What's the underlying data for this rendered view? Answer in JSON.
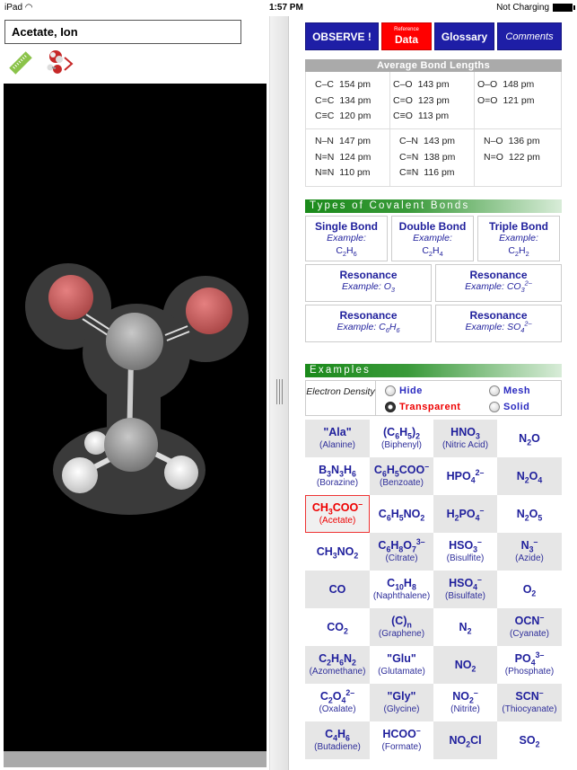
{
  "status_bar": {
    "device": "iPad",
    "time": "1:57 PM",
    "battery_text": "Not Charging"
  },
  "left": {
    "title_value": "Acetate, Ion",
    "icons": [
      "ruler-icon",
      "molecule-toggle-icon"
    ]
  },
  "nav": {
    "observe": "OBSERVE !",
    "reference_small": "Reference",
    "reference_big": "Data",
    "glossary": "Glossary",
    "comments": "Comments"
  },
  "bond_lengths": {
    "title": "Average Bond Lengths",
    "cells": [
      [
        [
          "C–C",
          "154 pm"
        ],
        [
          "C=C",
          "134 pm"
        ],
        [
          "C≡C",
          "120 pm"
        ]
      ],
      [
        [
          "C–O",
          "143 pm"
        ],
        [
          "C=O",
          "123 pm"
        ],
        [
          "C≡O",
          "113 pm"
        ]
      ],
      [
        [
          "O–O",
          "148 pm"
        ],
        [
          "O=O",
          "121 pm"
        ]
      ],
      [
        [
          "N–N",
          "147 pm"
        ],
        [
          "N=N",
          "124 pm"
        ],
        [
          "N≡N",
          "110 pm"
        ]
      ],
      [
        [
          "C–N",
          "143 pm"
        ],
        [
          "C=N",
          "138 pm"
        ],
        [
          "C≡N",
          "116 pm"
        ]
      ],
      [
        [
          "N–O",
          "136 pm"
        ],
        [
          "N=O",
          "122 pm"
        ]
      ]
    ]
  },
  "bond_types": {
    "title": "Types of Covalent Bonds",
    "example_label": "Example:",
    "row1": [
      {
        "title": "Single Bond",
        "formula_html": "C<sub>2</sub>H<sub>6</sub>"
      },
      {
        "title": "Double Bond",
        "formula_html": "C<sub>2</sub>H<sub>4</sub>"
      },
      {
        "title": "Triple Bond",
        "formula_html": "C<sub>2</sub>H<sub>2</sub>"
      }
    ],
    "row2": [
      {
        "title": "Resonance",
        "formula_html": "O<sub>3</sub>"
      },
      {
        "title": "Resonance",
        "formula_html": "CO<sub>3</sub><sup>2–</sup>"
      }
    ],
    "row3": [
      {
        "title": "Resonance",
        "formula_html": "C<sub>6</sub>H<sub>6</sub>"
      },
      {
        "title": "Resonance",
        "formula_html": "SO<sub>4</sub><sup>2–</sup>"
      }
    ]
  },
  "examples": {
    "title": "Examples",
    "electron_density_label": "Electron Density",
    "options": [
      {
        "label": "Hide",
        "selected": false
      },
      {
        "label": "Mesh",
        "selected": false
      },
      {
        "label": "Transparent",
        "selected": true
      },
      {
        "label": "Solid",
        "selected": false
      }
    ],
    "grid": [
      {
        "f": "\"Ala\"",
        "n": "(Alanine)",
        "g": true
      },
      {
        "f": "(C<sub>6</sub>H<sub>5</sub>)<sub>2</sub>",
        "n": "(Biphenyl)",
        "g": false
      },
      {
        "f": "HNO<sub>3</sub>",
        "n": "(Nitric Acid)",
        "g": true
      },
      {
        "f": "N<sub>2</sub>O",
        "n": "",
        "g": false
      },
      {
        "f": "B<sub>3</sub>N<sub>3</sub>H<sub>6</sub>",
        "n": "(Borazine)",
        "g": false
      },
      {
        "f": "C<sub>6</sub>H<sub>5</sub>COO<sup>–</sup>",
        "n": "(Benzoate)",
        "g": true
      },
      {
        "f": "HPO<sub>4</sub><sup>2–</sup>",
        "n": "",
        "g": false
      },
      {
        "f": "N<sub>2</sub>O<sub>4</sub>",
        "n": "",
        "g": true
      },
      {
        "f": "CH<sub>3</sub>COO<sup>–</sup>",
        "n": "(Acetate)",
        "g": true,
        "selected": true
      },
      {
        "f": "C<sub>6</sub>H<sub>5</sub>NO<sub>2</sub>",
        "n": "",
        "g": false
      },
      {
        "f": "H<sub>2</sub>PO<sub>4</sub><sup>–</sup>",
        "n": "",
        "g": true
      },
      {
        "f": "N<sub>2</sub>O<sub>5</sub>",
        "n": "",
        "g": false
      },
      {
        "f": "CH<sub>3</sub>NO<sub>2</sub>",
        "n": "",
        "g": false
      },
      {
        "f": "C<sub>6</sub>H<sub>8</sub>O<sub>7</sub><sup>3–</sup>",
        "n": "(Citrate)",
        "g": true
      },
      {
        "f": "HSO<sub>3</sub><sup>–</sup>",
        "n": "(Bisulfite)",
        "g": false
      },
      {
        "f": "N<sub>3</sub><sup>–</sup>",
        "n": "(Azide)",
        "g": true
      },
      {
        "f": "CO",
        "n": "",
        "g": true
      },
      {
        "f": "C<sub>10</sub>H<sub>8</sub>",
        "n": "(Naphthalene)",
        "g": false
      },
      {
        "f": "HSO<sub>4</sub><sup>–</sup>",
        "n": "(Bisulfate)",
        "g": true
      },
      {
        "f": "O<sub>2</sub>",
        "n": "",
        "g": false
      },
      {
        "f": "CO<sub>2</sub>",
        "n": "",
        "g": false
      },
      {
        "f": "(C)<sub>n</sub>",
        "n": "(Graphene)",
        "g": true
      },
      {
        "f": "N<sub>2</sub>",
        "n": "",
        "g": false
      },
      {
        "f": "OCN<sup>–</sup>",
        "n": "(Cyanate)",
        "g": true
      },
      {
        "f": "C<sub>2</sub>H<sub>6</sub>N<sub>2</sub>",
        "n": "(Azomethane)",
        "g": true
      },
      {
        "f": "\"Glu\"",
        "n": "(Glutamate)",
        "g": false
      },
      {
        "f": "NO<sub>2</sub>",
        "n": "",
        "g": true
      },
      {
        "f": "PO<sub>4</sub><sup>3–</sup>",
        "n": "(Phosphate)",
        "g": false
      },
      {
        "f": "C<sub>2</sub>O<sub>4</sub><sup>2–</sup>",
        "n": "(Oxalate)",
        "g": false
      },
      {
        "f": "\"Gly\"",
        "n": "(Glycine)",
        "g": true
      },
      {
        "f": "NO<sub>2</sub><sup>–</sup>",
        "n": "(Nitrite)",
        "g": false
      },
      {
        "f": "SCN<sup>–</sup>",
        "n": "(Thiocyanate)",
        "g": true
      },
      {
        "f": "C<sub>4</sub>H<sub>6</sub>",
        "n": "(Butadiene)",
        "g": true
      },
      {
        "f": "HCOO<sup>–</sup>",
        "n": "(Formate)",
        "g": false
      },
      {
        "f": "NO<sub>2</sub>Cl",
        "n": "",
        "g": true
      },
      {
        "f": "SO<sub>2</sub>",
        "n": "",
        "g": false
      }
    ]
  }
}
